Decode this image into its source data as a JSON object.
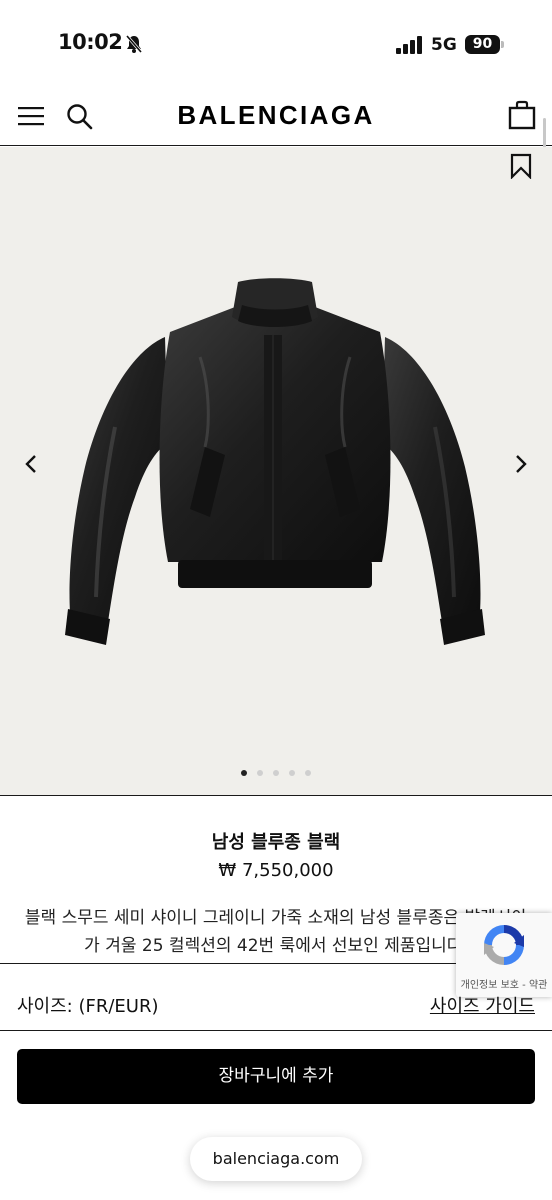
{
  "status_bar": {
    "time": "10:02",
    "network": "5G",
    "battery": "90"
  },
  "header": {
    "logo": "BALENCIAGA"
  },
  "gallery": {
    "total_images": 5,
    "active_index": 0,
    "background_color": "#f0efeb"
  },
  "product": {
    "name": "남성 블루종 블랙",
    "price": "₩ 7,550,000",
    "description": "블랙 스무드 세미 샤이니 그레이니 가죽 소재의 남성 블루종은 발렌시아가 겨울 25 컬렉션의 42번 룩에서 선보인 제품입니다."
  },
  "size": {
    "label": "사이즈: (FR/EUR)",
    "guide_link": "사이즈 가이드"
  },
  "cta": {
    "add_to_cart": "장바구니에 추가"
  },
  "browser": {
    "url": "balenciaga.com"
  },
  "recaptcha": {
    "terms": "개인정보 보호 - 약관"
  }
}
